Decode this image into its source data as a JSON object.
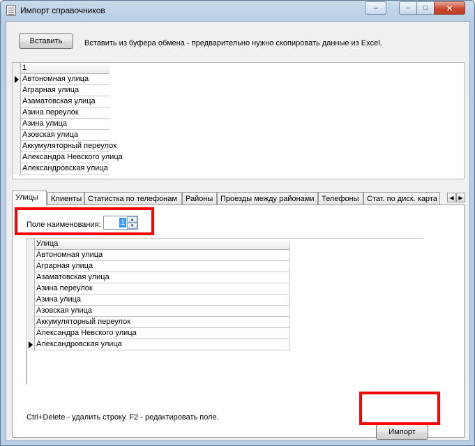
{
  "window": {
    "title": "Импорт справочников",
    "restore_glyph": "⇔",
    "min_glyph": "–",
    "max_glyph": "□",
    "close_glyph": "✕"
  },
  "toolbar": {
    "paste_label": "Вставить",
    "paste_hint": "Вставить из буфера обмена - предварительно нужно скопировать данные из Excel."
  },
  "import_grid": {
    "header": "1",
    "current_row": 0,
    "rows": [
      "Автономная улица",
      "Аграрная улица",
      "Азаматовская улица",
      "Азина переулок",
      "Азина улица",
      "Азовская улица",
      "Аккумуляторный переулок",
      "Александра Невского улица",
      "Александровская улица"
    ]
  },
  "tabs": {
    "items": [
      {
        "label": "Улицы",
        "active": true
      },
      {
        "label": "Клиенты",
        "active": false
      },
      {
        "label": "Статистка по телефонам",
        "active": false
      },
      {
        "label": "Районы",
        "active": false
      },
      {
        "label": "Проезды между районами",
        "active": false
      },
      {
        "label": "Телефоны",
        "active": false
      },
      {
        "label": "Стат. по диск. карта",
        "active": false
      }
    ],
    "scroll_left": "◀",
    "scroll_right": "▶"
  },
  "streets_panel": {
    "field_label": "Поле наименования:",
    "field_value": "1",
    "stepper_up": "▲",
    "stepper_down": "▼",
    "grid_header": "Улица",
    "current_row": 8,
    "rows": [
      "Автономная улица",
      "Аграрная улица",
      "Азаматовская улица",
      "Азина переулок",
      "Азина улица",
      "Азовская улица",
      "Аккумуляторный переулок",
      "Александра Невского улица",
      "Александровская улица"
    ],
    "hint": "Ctrl+Delete - удалить строку. F2 - редактировать поле.",
    "import_label": "Импорт"
  },
  "colors": {
    "highlight": "#ff0000",
    "selection": "#3399ff",
    "close_button": "#c94a31"
  }
}
